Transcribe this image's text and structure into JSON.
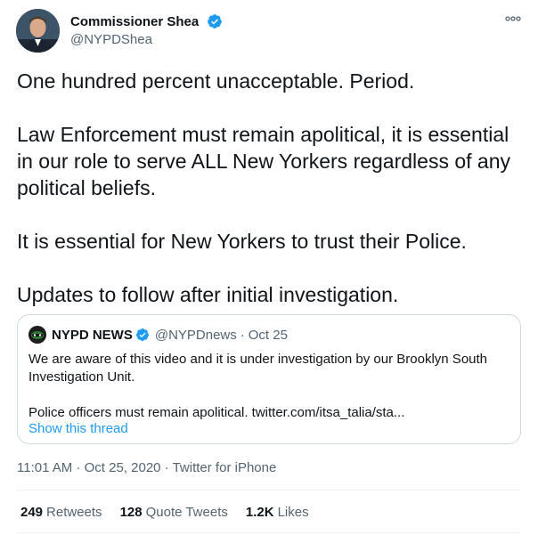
{
  "author": {
    "name": "Commissioner Shea",
    "handle": "@NYPDShea",
    "verified_color": "#1d9bf0"
  },
  "tweet": {
    "text": "One hundred percent unacceptable. Period.\n\nLaw Enforcement must remain apolitical, it is essential in our role to serve ALL New Yorkers regardless of any political beliefs.\n\nIt is essential for New Yorkers to trust their Police.\n\nUpdates to follow after initial investigation."
  },
  "quote": {
    "name": "NYPD NEWS",
    "handle": "@NYPDnews",
    "separator": "·",
    "date": "Oct 25",
    "text": "We are aware of this video and it is under investigation by our Brooklyn South Investigation Unit.\n\nPolice officers must remain apolitical. twitter.com/itsa_talia/sta...",
    "show_thread": "Show this thread"
  },
  "meta": {
    "time": "11:01 AM",
    "separator1": "·",
    "date": "Oct 25, 2020",
    "separator2": "·",
    "source": "Twitter for iPhone"
  },
  "stats": {
    "retweets_count": "249",
    "retweets_label": "Retweets",
    "quotes_count": "128",
    "quotes_label": "Quote Tweets",
    "likes_count": "1.2K",
    "likes_label": "Likes"
  },
  "icons": {
    "avatar": "profile-photo",
    "verified": "verified-badge-icon",
    "more": "more-options-icon"
  }
}
